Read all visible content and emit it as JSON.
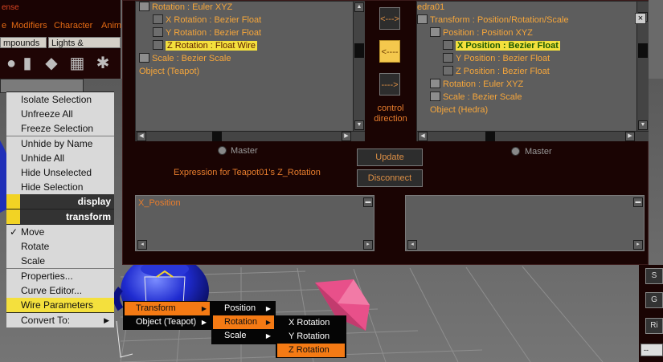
{
  "toolbar": {
    "title_fragment": "ense",
    "menus": [
      "e",
      "Modifiers",
      "Character",
      "Anim"
    ],
    "tabs": [
      "mpounds",
      "Lights & Cameras"
    ]
  },
  "icons": [
    "teapot-icon",
    "cylinder-icon",
    "diamond-icon",
    "grid-icon",
    "sparkle-icon"
  ],
  "quad": {
    "items_top": [
      "Isolate Selection",
      "Unfreeze All",
      "Freeze Selection",
      "Unhide by Name",
      "Unhide All",
      "Hide Unselected",
      "Hide Selection"
    ],
    "display_header": "display",
    "transform_header": "transform",
    "items_bottom": [
      "Move",
      "Rotate",
      "Scale",
      "Properties...",
      "Curve Editor...",
      "Wire Parameters",
      "Convert To:"
    ]
  },
  "dialog": {
    "left_tree": [
      {
        "label": "Rotation : Euler XYZ",
        "indent": 0,
        "icon": "controller-icon"
      },
      {
        "label": "X Rotation : Bezier Float",
        "indent": 1,
        "icon": "curve-icon"
      },
      {
        "label": "Y Rotation : Bezier Float",
        "indent": 1,
        "icon": "curve-icon"
      },
      {
        "label": "Z Rotation : Float Wire",
        "indent": 1,
        "icon": "curve-icon",
        "selected": true
      },
      {
        "label": "Scale : Bezier Scale",
        "indent": 0,
        "icon": "controller-icon"
      },
      {
        "label": "Object (Teapot)",
        "indent": 0,
        "icon": ""
      }
    ],
    "right_tree": [
      {
        "label": "edra01",
        "indent": 0,
        "icon": ""
      },
      {
        "label": "Transform : Position/Rotation/Scale",
        "indent": 0,
        "icon": "controller-icon"
      },
      {
        "label": "Position : Position XYZ",
        "indent": 1,
        "icon": "controller-icon"
      },
      {
        "label": "X Position : Bezier Float",
        "indent": 2,
        "icon": "curve-icon",
        "selected": true
      },
      {
        "label": "Y Position : Bezier Float",
        "indent": 2,
        "icon": "curve-icon"
      },
      {
        "label": "Z Position : Bezier Float",
        "indent": 2,
        "icon": "curve-icon"
      },
      {
        "label": "Rotation : Euler XYZ",
        "indent": 1,
        "icon": "controller-icon"
      },
      {
        "label": "Scale : Bezier Scale",
        "indent": 1,
        "icon": "controller-icon"
      },
      {
        "label": "Object (Hedra)",
        "indent": 1,
        "icon": ""
      }
    ],
    "dir_buttons": [
      "<--->",
      "<----",
      "---->"
    ],
    "control_direction": "control\ndirection",
    "master": "Master",
    "update": "Update",
    "disconnect": "Disconnect",
    "expression_label": "Expression for Teapot01's Z_Rotation",
    "expression_text": "X_Position",
    "expression_right": ""
  },
  "cascade": {
    "level1": [
      {
        "label": "Transform",
        "highlight": true
      },
      {
        "label": "Object (Teapot)",
        "highlight": false
      }
    ],
    "level2": [
      {
        "label": "Position",
        "highlight": false
      },
      {
        "label": "Rotation",
        "highlight": true
      },
      {
        "label": "Scale",
        "highlight": false
      }
    ],
    "level3": [
      {
        "label": "X Rotation",
        "highlight": false
      },
      {
        "label": "Y Rotation",
        "highlight": false
      },
      {
        "label": "Z Rotation",
        "highlight": true
      }
    ]
  },
  "right_panel": {
    "buttons": [
      "S",
      "G",
      "Ri"
    ],
    "dropdown": "--"
  }
}
